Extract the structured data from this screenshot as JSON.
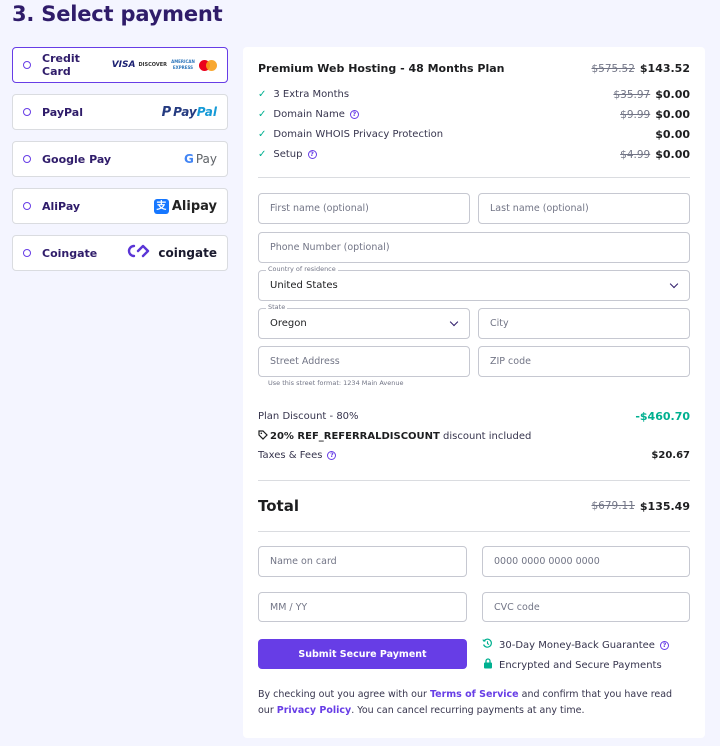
{
  "page_title": "3. Select payment",
  "methods": [
    {
      "label": "Credit Card",
      "selected": true
    },
    {
      "label": "PayPal",
      "selected": false
    },
    {
      "label": "Google Pay",
      "selected": false
    },
    {
      "label": "AliPay",
      "selected": false
    },
    {
      "label": "Coingate",
      "selected": false
    }
  ],
  "logos": {
    "visa": "VISA",
    "discover": "DISCOVER",
    "amex_line1": "AMERICAN",
    "amex_line2": "EXPRESS",
    "paypal_pay": "Pay",
    "paypal_pal": "Pal",
    "gpay_g": "G",
    "gpay_pay": "Pay",
    "alipay": "Alipay",
    "coingate": "coingate"
  },
  "order": {
    "plan": {
      "name": "Premium Web Hosting - 48 Months Plan",
      "old_price": "$575.52",
      "price": "$143.52"
    },
    "items": [
      {
        "label": "3 Extra Months",
        "old_price": "$35.97",
        "price": "$0.00"
      },
      {
        "label": "Domain Name",
        "old_price": "$9.99",
        "price": "$0.00"
      },
      {
        "label": "Domain WHOIS Privacy Protection",
        "old_price": "",
        "price": "$0.00"
      },
      {
        "label": "Setup",
        "old_price": "$4.99",
        "price": "$0.00"
      }
    ]
  },
  "form": {
    "first_name_placeholder": "First name (optional)",
    "last_name_placeholder": "Last name (optional)",
    "phone_placeholder": "Phone Number (optional)",
    "country_label": "Country of residence",
    "country_value": "United States",
    "state_label": "State",
    "state_value": "Oregon",
    "city_placeholder": "City",
    "street_placeholder": "Street Address",
    "zip_placeholder": "ZIP code",
    "street_hint": "Use this street format: 1234 Main Avenue"
  },
  "summary": {
    "plan_discount_label": "Plan Discount - 80%",
    "plan_discount_value": "-$460.70",
    "coupon_code": "20% REF_REFERRALDISCOUNT",
    "coupon_suffix": "discount included",
    "taxes_label": "Taxes & Fees",
    "taxes_value": "$20.67",
    "total_label": "Total",
    "total_old": "$679.11",
    "total_value": "$135.49"
  },
  "card": {
    "name_placeholder": "Name on card",
    "number_placeholder": "0000 0000 0000 0000",
    "expiry_placeholder": "MM / YY",
    "cvc_placeholder": "CVC code"
  },
  "submit_label": "Submit Secure Payment",
  "guarantees": [
    "30-Day Money-Back Guarantee",
    "Encrypted and Secure Payments"
  ],
  "terms": {
    "part1": "By checking out you agree with our ",
    "tos_link": "Terms of Service",
    "part2": " and confirm that you have read our ",
    "privacy_link": "Privacy Policy",
    "part3": ". You can cancel recurring payments at any time."
  },
  "colors": {
    "accent": "#673de6",
    "success": "#00b090",
    "title": "#2f1c6a"
  }
}
